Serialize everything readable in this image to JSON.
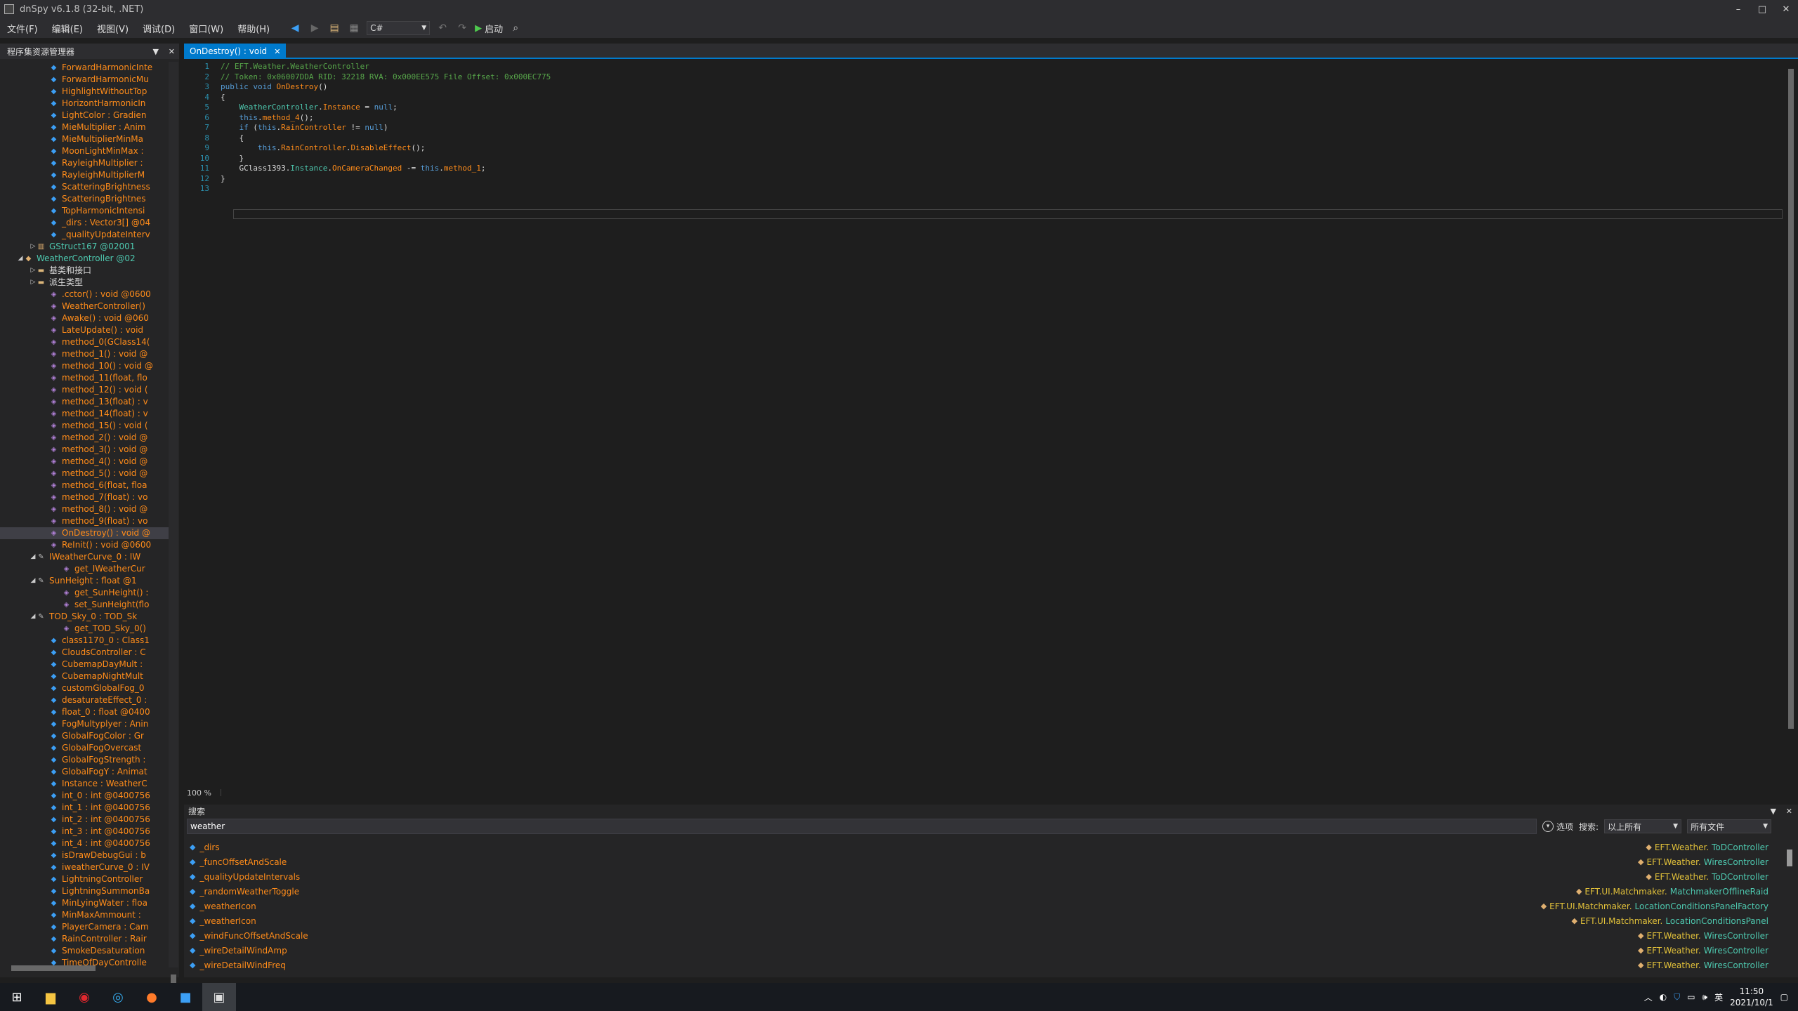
{
  "window": {
    "title": "dnSpy v6.1.8 (32-bit, .NET)",
    "controls": [
      "–",
      "□",
      "✕"
    ]
  },
  "menu": [
    "文件(F)",
    "编辑(E)",
    "视图(V)",
    "调试(D)",
    "窗口(W)",
    "帮助(H)"
  ],
  "toolbar": {
    "language": "C#",
    "start_label": "启动"
  },
  "assembly_explorer": {
    "title": "程序集资源管理器",
    "tree": [
      {
        "kind": "field",
        "label": "ForwardHarmonicInte",
        "indent": 5
      },
      {
        "kind": "field",
        "label": "ForwardHarmonicMu",
        "indent": 5
      },
      {
        "kind": "field",
        "label": "HighlightWithoutTop",
        "indent": 5
      },
      {
        "kind": "field",
        "label": "HorizontHarmonicIn",
        "indent": 5
      },
      {
        "kind": "field",
        "label": "LightColor : Gradien",
        "indent": 5
      },
      {
        "kind": "field",
        "label": "MieMultiplier : Anim",
        "indent": 5
      },
      {
        "kind": "field",
        "label": "MieMultiplierMinMa",
        "indent": 5
      },
      {
        "kind": "field",
        "label": "MoonLightMinMax :",
        "indent": 5
      },
      {
        "kind": "field",
        "label": "RayleighMultiplier :",
        "indent": 5
      },
      {
        "kind": "field",
        "label": "RayleighMultiplierM",
        "indent": 5
      },
      {
        "kind": "field",
        "label": "ScatteringBrightness",
        "indent": 5
      },
      {
        "kind": "field",
        "label": "ScatteringBrightnes",
        "indent": 5
      },
      {
        "kind": "field",
        "label": "TopHarmonicIntensi",
        "indent": 5
      },
      {
        "kind": "field",
        "label": "_dirs : Vector3[] @04",
        "indent": 5
      },
      {
        "kind": "field",
        "label": "_qualityUpdateInterv",
        "indent": 5
      },
      {
        "kind": "struct",
        "label": "GStruct167 @02001",
        "indent": 4,
        "exp": "▷"
      },
      {
        "kind": "class",
        "label": "WeatherController @02",
        "indent": 3,
        "exp": "◢"
      },
      {
        "kind": "folder",
        "label": "基类和接口",
        "indent": 4,
        "exp": "▷"
      },
      {
        "kind": "folder",
        "label": "派生类型",
        "indent": 4,
        "exp": "▷"
      },
      {
        "kind": "method",
        "label": ".cctor() : void @0600",
        "indent": 5
      },
      {
        "kind": "method",
        "label": "WeatherController()",
        "indent": 5
      },
      {
        "kind": "method",
        "label": "Awake() : void @060",
        "indent": 5
      },
      {
        "kind": "method",
        "label": "LateUpdate() : void",
        "indent": 5
      },
      {
        "kind": "method",
        "label": "method_0(GClass14(",
        "indent": 5
      },
      {
        "kind": "method",
        "label": "method_1() : void @",
        "indent": 5
      },
      {
        "kind": "method",
        "label": "method_10() : void @",
        "indent": 5
      },
      {
        "kind": "method",
        "label": "method_11(float, flo",
        "indent": 5
      },
      {
        "kind": "method",
        "label": "method_12() : void (",
        "indent": 5
      },
      {
        "kind": "method",
        "label": "method_13(float) : v",
        "indent": 5
      },
      {
        "kind": "method",
        "label": "method_14(float) : v",
        "indent": 5
      },
      {
        "kind": "method",
        "label": "method_15() : void (",
        "indent": 5
      },
      {
        "kind": "method",
        "label": "method_2() : void @",
        "indent": 5
      },
      {
        "kind": "method",
        "label": "method_3() : void @",
        "indent": 5
      },
      {
        "kind": "method",
        "label": "method_4() : void @",
        "indent": 5
      },
      {
        "kind": "method",
        "label": "method_5() : void @",
        "indent": 5
      },
      {
        "kind": "method",
        "label": "method_6(float, floa",
        "indent": 5
      },
      {
        "kind": "method",
        "label": "method_7(float) : vo",
        "indent": 5
      },
      {
        "kind": "method",
        "label": "method_8() : void @",
        "indent": 5
      },
      {
        "kind": "method",
        "label": "method_9(float) : vo",
        "indent": 5
      },
      {
        "kind": "method",
        "label": "OnDestroy() : void @",
        "indent": 5,
        "selected": true
      },
      {
        "kind": "method",
        "label": "ReInit() : void @0600",
        "indent": 5
      },
      {
        "kind": "prop",
        "label": "IWeatherCurve_0 : IW",
        "indent": 4,
        "exp": "◢"
      },
      {
        "kind": "method",
        "label": "get_IWeatherCur",
        "indent": 6
      },
      {
        "kind": "prop",
        "label": "SunHeight : float @1",
        "indent": 4,
        "exp": "◢"
      },
      {
        "kind": "method",
        "label": "get_SunHeight() :",
        "indent": 6
      },
      {
        "kind": "method",
        "label": "set_SunHeight(flo",
        "indent": 6
      },
      {
        "kind": "prop",
        "label": "TOD_Sky_0 : TOD_Sk",
        "indent": 4,
        "exp": "◢"
      },
      {
        "kind": "method",
        "label": "get_TOD_Sky_0()",
        "indent": 6
      },
      {
        "kind": "field",
        "label": "class1170_0 : Class1",
        "indent": 5
      },
      {
        "kind": "field",
        "label": "CloudsController : C",
        "indent": 5
      },
      {
        "kind": "field",
        "label": "CubemapDayMult :",
        "indent": 5
      },
      {
        "kind": "field",
        "label": "CubemapNightMult",
        "indent": 5
      },
      {
        "kind": "field",
        "label": "customGlobalFog_0",
        "indent": 5
      },
      {
        "kind": "field",
        "label": "desaturateEffect_0 :",
        "indent": 5
      },
      {
        "kind": "field",
        "label": "float_0 : float @0400",
        "indent": 5
      },
      {
        "kind": "field",
        "label": "FogMultyplyer : Anin",
        "indent": 5
      },
      {
        "kind": "field",
        "label": "GlobalFogColor : Gr",
        "indent": 5
      },
      {
        "kind": "field",
        "label": "GlobalFogOvercast",
        "indent": 5
      },
      {
        "kind": "field",
        "label": "GlobalFogStrength :",
        "indent": 5
      },
      {
        "kind": "field",
        "label": "GlobalFogY : Animat",
        "indent": 5
      },
      {
        "kind": "field",
        "label": "Instance : WeatherC",
        "indent": 5
      },
      {
        "kind": "field",
        "label": "int_0 : int @0400756",
        "indent": 5
      },
      {
        "kind": "field",
        "label": "int_1 : int @0400756",
        "indent": 5
      },
      {
        "kind": "field",
        "label": "int_2 : int @0400756",
        "indent": 5
      },
      {
        "kind": "field",
        "label": "int_3 : int @0400756",
        "indent": 5
      },
      {
        "kind": "field",
        "label": "int_4 : int @0400756",
        "indent": 5
      },
      {
        "kind": "field",
        "label": "isDrawDebugGui : b",
        "indent": 5
      },
      {
        "kind": "field",
        "label": "iweatherCurve_0 : IV",
        "indent": 5
      },
      {
        "kind": "field",
        "label": "LightningController",
        "indent": 5
      },
      {
        "kind": "field",
        "label": "LightningSummonBa",
        "indent": 5
      },
      {
        "kind": "field",
        "label": "MinLyingWater : floa",
        "indent": 5
      },
      {
        "kind": "field",
        "label": "MinMaxAmmount :",
        "indent": 5
      },
      {
        "kind": "field",
        "label": "PlayerCamera : Cam",
        "indent": 5
      },
      {
        "kind": "field",
        "label": "RainController : Rair",
        "indent": 5
      },
      {
        "kind": "field",
        "label": "SmokeDesaturation",
        "indent": 5
      },
      {
        "kind": "field",
        "label": "TimeOfDayControlle",
        "indent": 5
      }
    ]
  },
  "editor": {
    "tab_label": "OnDestroy() : void",
    "zoom": "100 %",
    "lines": [
      [
        [
          "c-com",
          "// EFT.Weather.WeatherController"
        ]
      ],
      [
        [
          "c-com",
          "// Token: 0x06007DDA RID: 32218 RVA: 0x000EE575 File Offset: 0x000EC775"
        ]
      ],
      [
        [
          "c-kw",
          "public void "
        ],
        [
          "c-meth",
          "OnDestroy"
        ],
        [
          "",
          "()"
        ]
      ],
      [
        [
          "",
          "{"
        ]
      ],
      [
        [
          "",
          "    "
        ],
        [
          "c-type",
          "WeatherController"
        ],
        [
          "",
          "."
        ],
        [
          "c-fld",
          "Instance"
        ],
        [
          "",
          " = "
        ],
        [
          "c-kw",
          "null"
        ],
        [
          "",
          ";"
        ]
      ],
      [
        [
          "",
          "    "
        ],
        [
          "c-kw",
          "this"
        ],
        [
          "",
          "."
        ],
        [
          "c-meth",
          "method_4"
        ],
        [
          "",
          "();"
        ]
      ],
      [
        [
          "",
          "    "
        ],
        [
          "c-kw",
          "if"
        ],
        [
          "",
          " ("
        ],
        [
          "c-kw",
          "this"
        ],
        [
          "",
          "."
        ],
        [
          "c-fld",
          "RainController"
        ],
        [
          "",
          " != "
        ],
        [
          "c-kw",
          "null"
        ],
        [
          "",
          ")"
        ]
      ],
      [
        [
          "",
          "    {"
        ]
      ],
      [
        [
          "",
          "        "
        ],
        [
          "c-kw",
          "this"
        ],
        [
          "",
          "."
        ],
        [
          "c-fld",
          "RainController"
        ],
        [
          "",
          "."
        ],
        [
          "c-meth",
          "DisableEffect"
        ],
        [
          "",
          "();"
        ]
      ],
      [
        [
          "",
          "    }"
        ]
      ],
      [
        [
          "",
          "    GClass1393."
        ],
        [
          "c-prop",
          "Instance"
        ],
        [
          "",
          "."
        ],
        [
          "c-fld",
          "OnCameraChanged"
        ],
        [
          "",
          " -= "
        ],
        [
          "c-kw",
          "this"
        ],
        [
          "",
          "."
        ],
        [
          "c-meth",
          "method_1"
        ],
        [
          "",
          ";"
        ]
      ],
      [
        [
          "",
          "}"
        ]
      ],
      [
        [
          "",
          ""
        ]
      ]
    ]
  },
  "search": {
    "title": "搜索",
    "query": "weather",
    "options_label": "选项",
    "search_label": "搜索:",
    "scope": "以上所有",
    "files": "所有文件",
    "results": [
      {
        "name": "_dirs",
        "ns": "EFT.Weather.",
        "cls": "ToDController"
      },
      {
        "name": "_funcOffsetAndScale",
        "ns": "EFT.Weather.",
        "cls": "WiresController"
      },
      {
        "name": "_qualityUpdateIntervals",
        "ns": "EFT.Weather.",
        "cls": "ToDController"
      },
      {
        "name": "_randomWeatherToggle",
        "ns": "EFT.UI.Matchmaker.",
        "cls": "MatchmakerOfflineRaid"
      },
      {
        "name": "_weatherIcon",
        "ns": "EFT.UI.Matchmaker.",
        "cls": "LocationConditionsPanelFactory"
      },
      {
        "name": "_weatherIcon",
        "ns": "EFT.UI.Matchmaker.",
        "cls": "LocationConditionsPanel"
      },
      {
        "name": "_windFuncOffsetAndScale",
        "ns": "EFT.Weather.",
        "cls": "WiresController"
      },
      {
        "name": "_wireDetailWindAmp",
        "ns": "EFT.Weather.",
        "cls": "WiresController"
      },
      {
        "name": "_wireDetailWindFreq",
        "ns": "EFT.Weather.",
        "cls": "WiresController"
      },
      {
        "name": "",
        "ns": "EFT.Weather.",
        "cls": "WiresController"
      }
    ]
  },
  "taskbar": {
    "time": "11:50",
    "date": "2021/10/1",
    "ime": "英"
  }
}
